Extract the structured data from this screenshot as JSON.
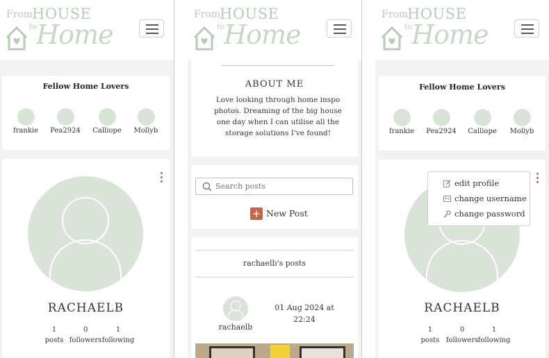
{
  "logo": {
    "from": "From",
    "house": "HOUSE",
    "to": "to",
    "home": "Home"
  },
  "fellow": {
    "title": "Fellow Home Lovers",
    "users": [
      "frankie",
      "Pea2924",
      "Calliope",
      "Mollyb"
    ]
  },
  "profile": {
    "username": "RACHAELB",
    "stats": [
      {
        "count": "1",
        "label": "posts"
      },
      {
        "count": "0",
        "label": "followers"
      },
      {
        "count": "1",
        "label": "following"
      }
    ]
  },
  "about": {
    "title": "ABOUT ME",
    "text": "Love looking through home inspo photos. Dreaming of the big house one day when I can utilise all the storage solutions I've found!"
  },
  "search": {
    "placeholder": "Search posts"
  },
  "new_post": {
    "label": "New Post"
  },
  "posts_header": "rachaelb's posts",
  "post": {
    "author": "rachaelb",
    "date": "01 Aug 2024 at",
    "time": "22:24"
  },
  "menu": {
    "items": [
      {
        "label": "edit profile",
        "icon": "edit-icon"
      },
      {
        "label": "change username",
        "icon": "id-card-icon"
      },
      {
        "label": "change password",
        "icon": "key-icon"
      }
    ]
  },
  "colors": {
    "accent": "#c0664a",
    "avatar": "#d9e3d8",
    "logo": "#b7ccb6"
  }
}
